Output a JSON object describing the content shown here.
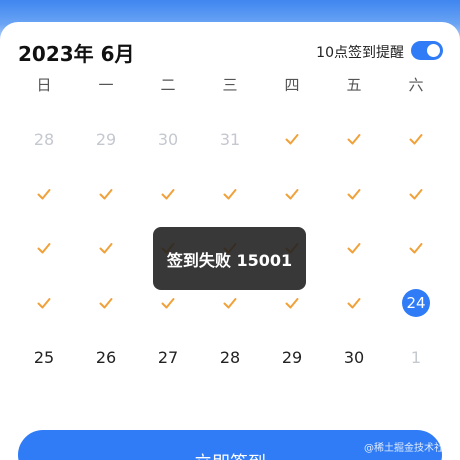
{
  "header": {
    "month_title": "2023年 6月",
    "remind_label": "10点签到提醒",
    "remind_on": true
  },
  "weekdays": [
    "日",
    "一",
    "二",
    "三",
    "四",
    "五",
    "六"
  ],
  "colors": {
    "accent": "#2f7cf6",
    "check": "#f0a13a",
    "muted": "#c4c8cf"
  },
  "icons": {
    "check": "checkmark-icon"
  },
  "calendar": {
    "weeks": [
      [
        {
          "t": "prev",
          "v": "28"
        },
        {
          "t": "prev",
          "v": "29"
        },
        {
          "t": "prev",
          "v": "30"
        },
        {
          "t": "prev",
          "v": "31"
        },
        {
          "t": "check"
        },
        {
          "t": "check"
        },
        {
          "t": "check"
        }
      ],
      [
        {
          "t": "check"
        },
        {
          "t": "check"
        },
        {
          "t": "check"
        },
        {
          "t": "check"
        },
        {
          "t": "check"
        },
        {
          "t": "check"
        },
        {
          "t": "check"
        }
      ],
      [
        {
          "t": "check"
        },
        {
          "t": "check"
        },
        {
          "t": "check"
        },
        {
          "t": "check"
        },
        {
          "t": "check"
        },
        {
          "t": "check"
        },
        {
          "t": "check"
        }
      ],
      [
        {
          "t": "check"
        },
        {
          "t": "check"
        },
        {
          "t": "check"
        },
        {
          "t": "check"
        },
        {
          "t": "check"
        },
        {
          "t": "check"
        },
        {
          "t": "today",
          "v": "24"
        }
      ],
      [
        {
          "t": "normal",
          "v": "25"
        },
        {
          "t": "normal",
          "v": "26"
        },
        {
          "t": "normal",
          "v": "27"
        },
        {
          "t": "normal",
          "v": "28"
        },
        {
          "t": "normal",
          "v": "29"
        },
        {
          "t": "normal",
          "v": "30"
        },
        {
          "t": "next",
          "v": "1"
        }
      ]
    ]
  },
  "toast": {
    "text": "签到失败 15001"
  },
  "checkin_button": {
    "label": "立即签到"
  },
  "watermark": "@稀土掘金技术社区"
}
